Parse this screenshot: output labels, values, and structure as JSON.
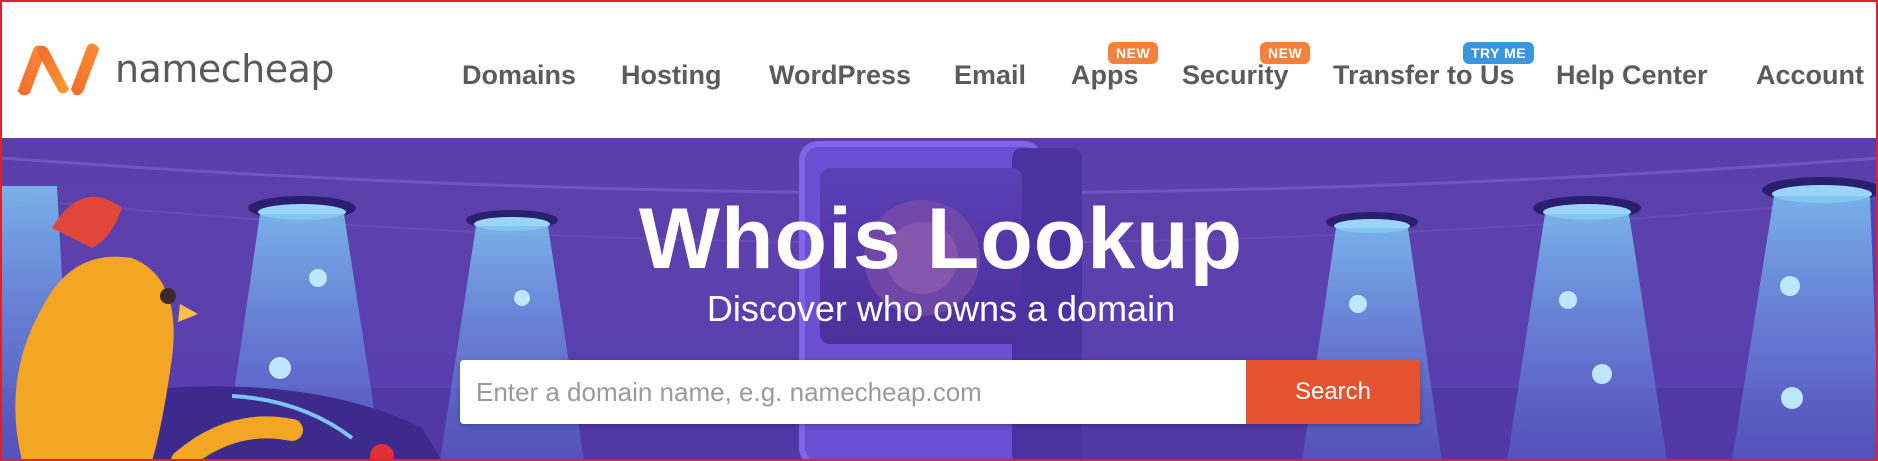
{
  "brand": {
    "name": "namecheap",
    "logo_icon": "namecheap-n-logo-icon",
    "logo_gradient": [
      "#f4662e",
      "#f9a02f"
    ]
  },
  "nav": {
    "items": [
      {
        "label": "Domains"
      },
      {
        "label": "Hosting"
      },
      {
        "label": "WordPress"
      },
      {
        "label": "Email"
      },
      {
        "label": "Apps",
        "badge": "NEW"
      },
      {
        "label": "Security",
        "badge": "NEW"
      },
      {
        "label": "Transfer to Us",
        "badge": "TRY ME"
      },
      {
        "label": "Help Center"
      },
      {
        "label": "Account"
      }
    ]
  },
  "hero": {
    "title": "Whois Lookup",
    "subtitle": "Discover who owns a domain",
    "search_placeholder": "Enter a domain name, e.g. namecheap.com",
    "search_button": "Search",
    "background_color": "#5a3ea8",
    "button_color": "#e4522f"
  },
  "colors": {
    "badge_new": "#f3813a",
    "badge_try": "#3b95e0",
    "nav_text": "#5b5b5b",
    "frame_border": "#d9232e"
  }
}
